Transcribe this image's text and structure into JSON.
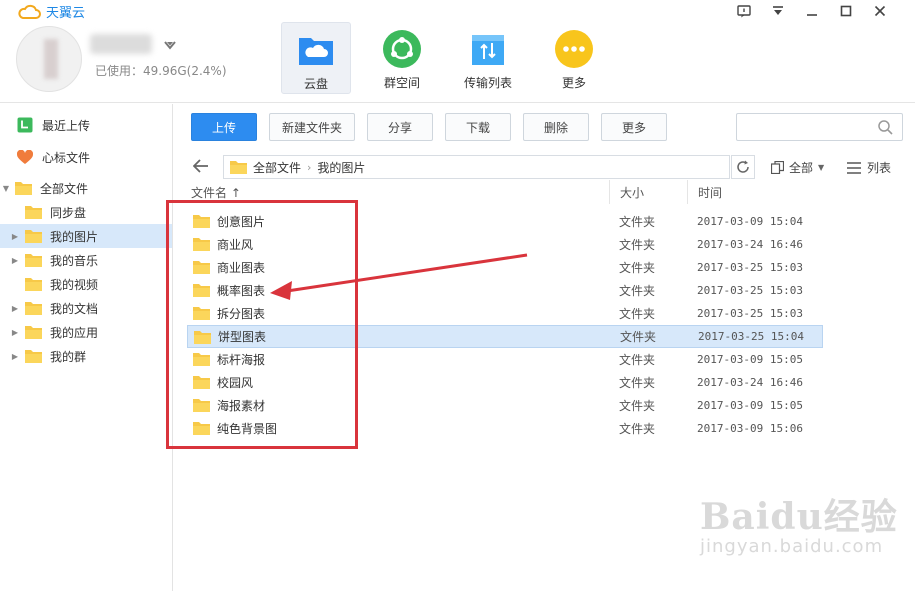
{
  "app": {
    "title": "天翼云"
  },
  "header": {
    "usage": "已使用：49.96G(2.4%)",
    "tabs": [
      {
        "label": "云盘",
        "icon": "cloud-disk-icon",
        "color": "#2d8cf0",
        "active": true
      },
      {
        "label": "群空间",
        "icon": "group-space-icon",
        "color": "#3cb95c",
        "active": false
      },
      {
        "label": "传输列表",
        "icon": "transfer-list-icon",
        "color": "#3ea9f5",
        "active": false
      },
      {
        "label": "更多",
        "icon": "more-icon",
        "color": "#f8c51c",
        "active": false
      }
    ]
  },
  "sidebar": {
    "items": [
      {
        "label": "最近上传",
        "icon": "recent-upload-icon"
      },
      {
        "label": "心标文件",
        "icon": "heart-icon"
      },
      {
        "label": "全部文件",
        "icon": "folder-icon",
        "expanded": true
      },
      {
        "label": "同步盘",
        "icon": "folder-icon"
      },
      {
        "label": "我的图片",
        "icon": "folder-icon",
        "selected": true
      },
      {
        "label": "我的音乐",
        "icon": "folder-icon"
      },
      {
        "label": "我的视频",
        "icon": "folder-icon"
      },
      {
        "label": "我的文档",
        "icon": "folder-icon"
      },
      {
        "label": "我的应用",
        "icon": "folder-icon"
      },
      {
        "label": "我的群",
        "icon": "folder-icon"
      }
    ]
  },
  "toolbar": {
    "upload": "上传",
    "new_folder": "新建文件夹",
    "share": "分享",
    "download": "下载",
    "delete": "删除",
    "more": "更多"
  },
  "path": {
    "root": "全部文件",
    "current": "我的图片"
  },
  "view": {
    "all": "全部",
    "list": "列表"
  },
  "table": {
    "columns": {
      "name": "文件名 ↑",
      "size": "大小",
      "time": "时间"
    },
    "rows": [
      {
        "name": "创意图片",
        "type": "文件夹",
        "time": "2017-03-09 15:04"
      },
      {
        "name": "商业风",
        "type": "文件夹",
        "time": "2017-03-24 16:46"
      },
      {
        "name": "商业图表",
        "type": "文件夹",
        "time": "2017-03-25 15:03"
      },
      {
        "name": "概率图表",
        "type": "文件夹",
        "time": "2017-03-25 15:03"
      },
      {
        "name": "拆分图表",
        "type": "文件夹",
        "time": "2017-03-25 15:03"
      },
      {
        "name": "饼型图表",
        "type": "文件夹",
        "time": "2017-03-25 15:04",
        "selected": true
      },
      {
        "name": "标杆海报",
        "type": "文件夹",
        "time": "2017-03-09 15:05"
      },
      {
        "name": "校园风",
        "type": "文件夹",
        "time": "2017-03-24 16:46"
      },
      {
        "name": "海报素材",
        "type": "文件夹",
        "time": "2017-03-09 15:05"
      },
      {
        "name": "纯色背景图",
        "type": "文件夹",
        "time": "2017-03-09 15:06"
      }
    ]
  },
  "watermark": {
    "brand": "Baidu经验",
    "url": "jingyan.baidu.com"
  },
  "colors": {
    "accent": "#2d8cf0",
    "folder": "#f7c948",
    "annotation": "#d9343c",
    "selection": "#d7e8fa"
  }
}
